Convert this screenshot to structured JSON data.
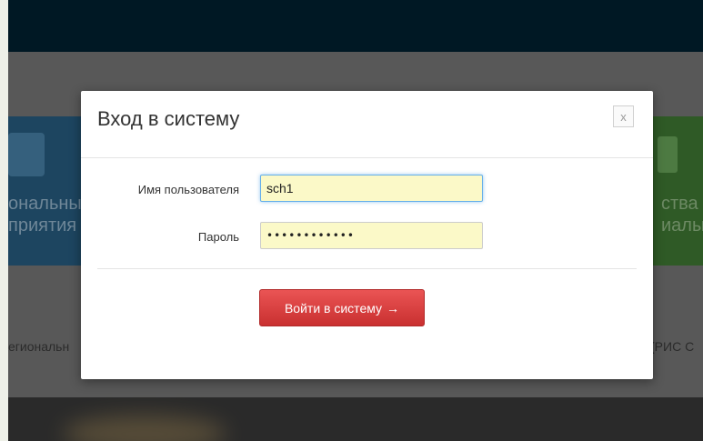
{
  "background": {
    "left_tile_text": "ональны\nприятия",
    "right_tile_text": "ства\nиалы",
    "left_line_text": "егиональн",
    "right_line_text": "(РИС С"
  },
  "modal": {
    "title": "Вход в систему",
    "close_label": "x",
    "username_label": "Имя пользователя",
    "username_value": "sch1",
    "password_label": "Пароль",
    "password_value": "••••••••••••",
    "submit_label": "Войти в систему",
    "submit_arrow": "→"
  },
  "colors": {
    "submit_button": "#d9403f",
    "input_autofill": "#fbf9c8",
    "topbar": "#001824",
    "overlay": "#585858"
  }
}
